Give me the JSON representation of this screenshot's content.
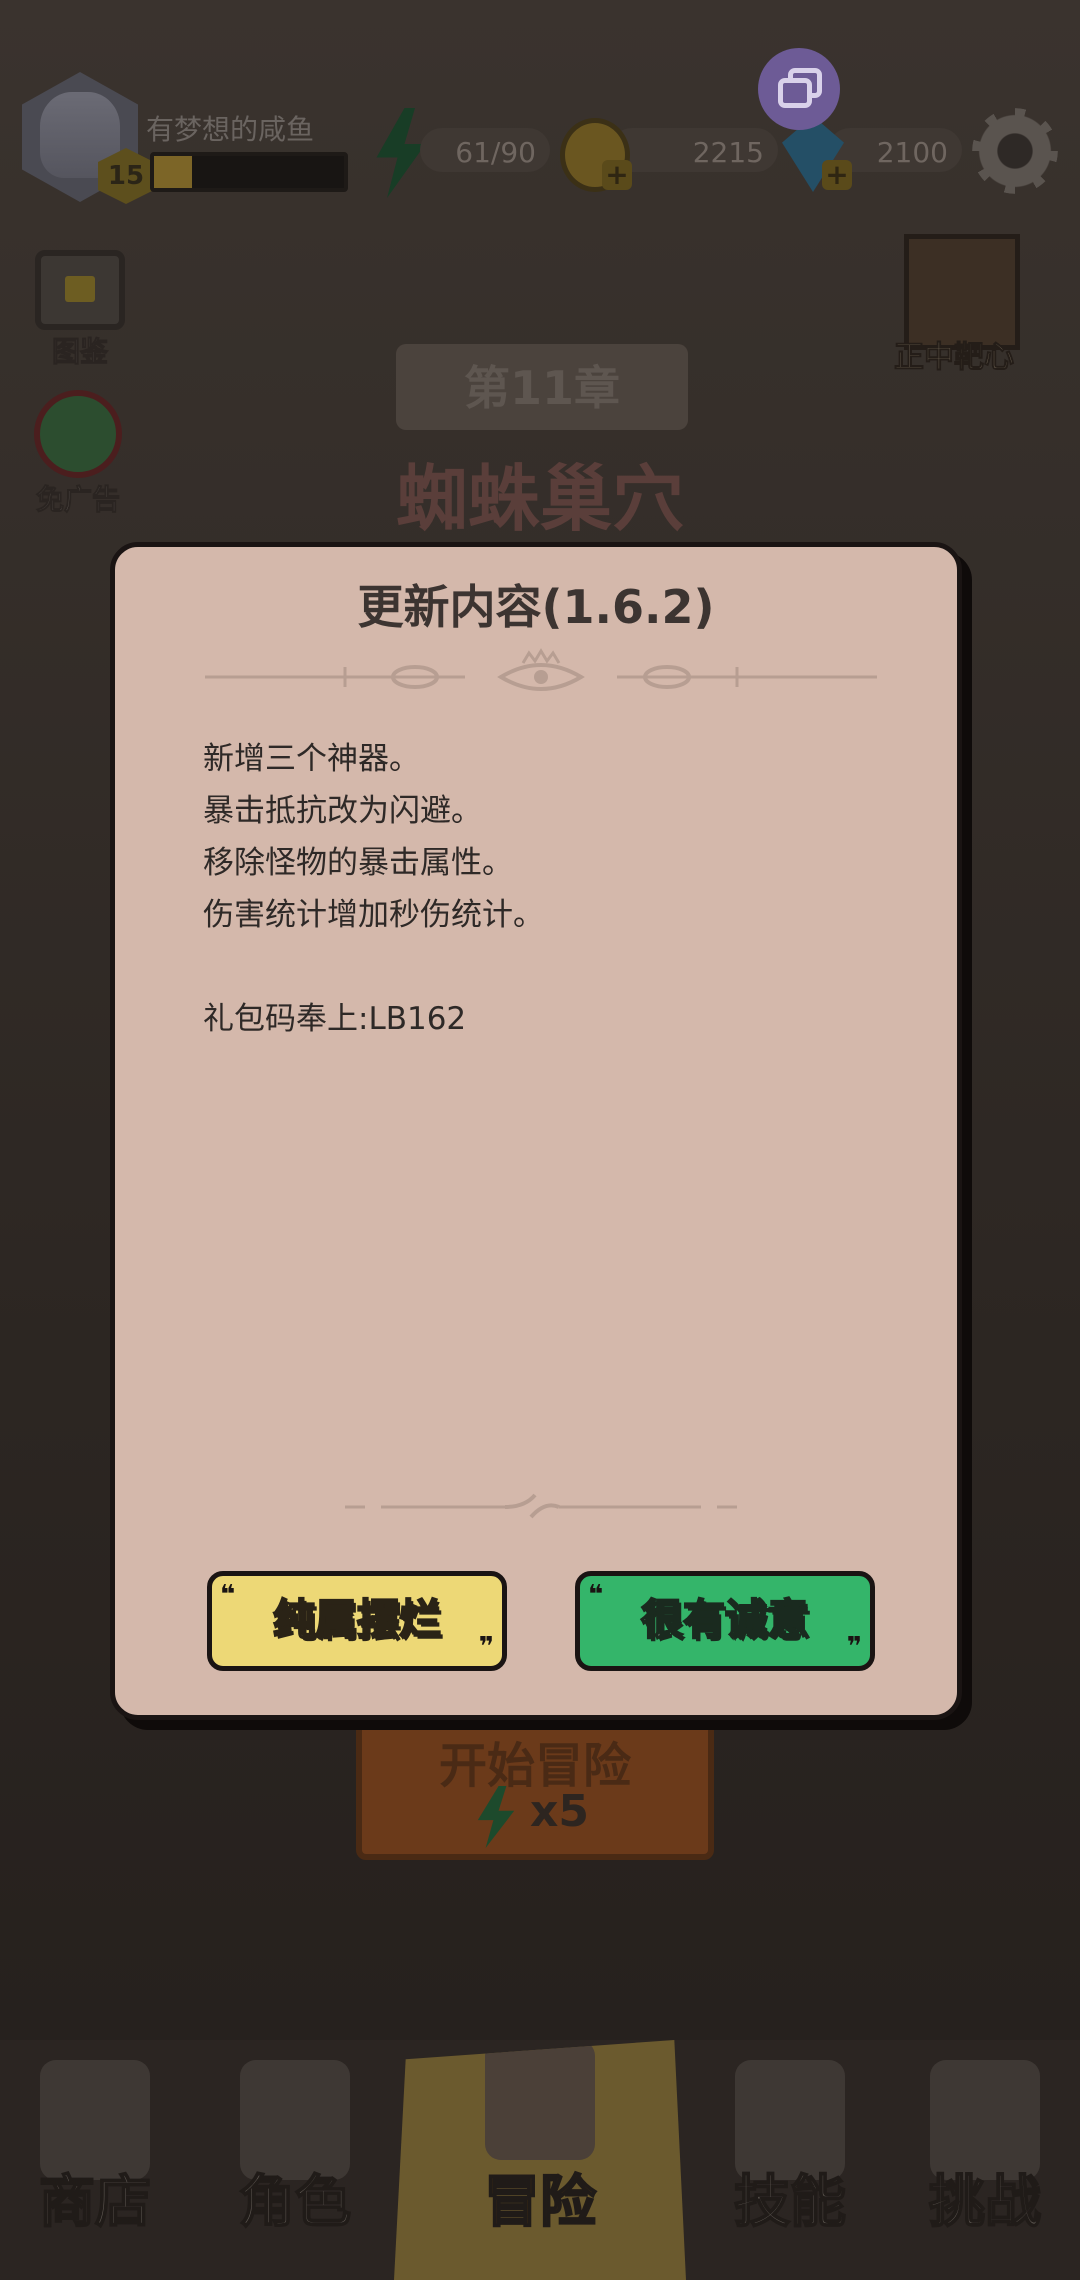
{
  "player": {
    "nickname": "有梦想的咸鱼",
    "level": "15",
    "xp_fraction": 0.2
  },
  "resources": {
    "energy": "61/90",
    "coins": "2215",
    "gems": "2100"
  },
  "side_buttons": {
    "codex_label": "图鉴",
    "no_ads_label": "免广告",
    "bonus_label": "正中靶心"
  },
  "chapter": {
    "number_label": "第11章",
    "name": "蜘蛛巢穴"
  },
  "start": {
    "label": "开始冒险",
    "cost": "x5"
  },
  "bottom_nav": {
    "tabs": [
      {
        "label": "商店",
        "icon": "shop-icon"
      },
      {
        "label": "角色",
        "icon": "helmet-icon"
      },
      {
        "label": "冒险",
        "icon": "crossed-swords-icon"
      },
      {
        "label": "技能",
        "icon": "spellbook-icon"
      },
      {
        "label": "挑战",
        "icon": "sword-icon"
      }
    ],
    "active_index": 2
  },
  "modal": {
    "title": "更新内容(1.6.2)",
    "lines": [
      "新增三个神器。",
      "暴击抵抗改为闪避。",
      "移除怪物的暴击属性。",
      "伤害统计增加秒伤统计。"
    ],
    "gift_code_line": "礼包码奉上:LB162",
    "reject_label": "纯属摆烂",
    "accept_label": "很有诚意"
  },
  "colors": {
    "modal_bg": "#d4b8ab",
    "reject_btn": "#edd876",
    "accept_btn": "#34b56a",
    "overlay_bg": "#3b342f"
  }
}
